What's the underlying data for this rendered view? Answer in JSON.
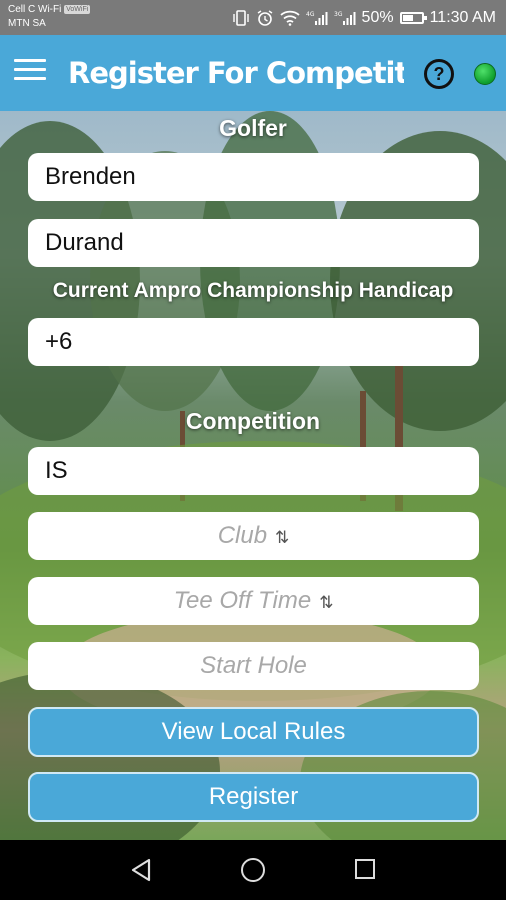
{
  "status_bar": {
    "carrier_line1": "Cell C Wi-Fi",
    "wifi_badge": "VoWiFi",
    "carrier_line2": "MTN SA",
    "battery_percent": "50%",
    "battery_level": 0.5,
    "time": "11:30 AM"
  },
  "app_bar": {
    "title": "Register For Competitio",
    "help_label": "?",
    "status_color": "#1bb23e"
  },
  "form": {
    "golfer_label": "Golfer",
    "first_name": "Brenden",
    "last_name": "Durand",
    "handicap_label": "Current Ampro Championship Handicap",
    "handicap_value": "+6",
    "competition_label": "Competition",
    "competition_value": "IS",
    "club_placeholder": "Club",
    "tee_off_placeholder": "Tee Off Time",
    "start_hole_placeholder": "Start Hole",
    "sort_icon": "⇅",
    "view_rules_label": "View Local Rules",
    "register_label": "Register"
  },
  "colors": {
    "accent": "#4aa8d8",
    "status_bar": "#7a7a7a"
  }
}
